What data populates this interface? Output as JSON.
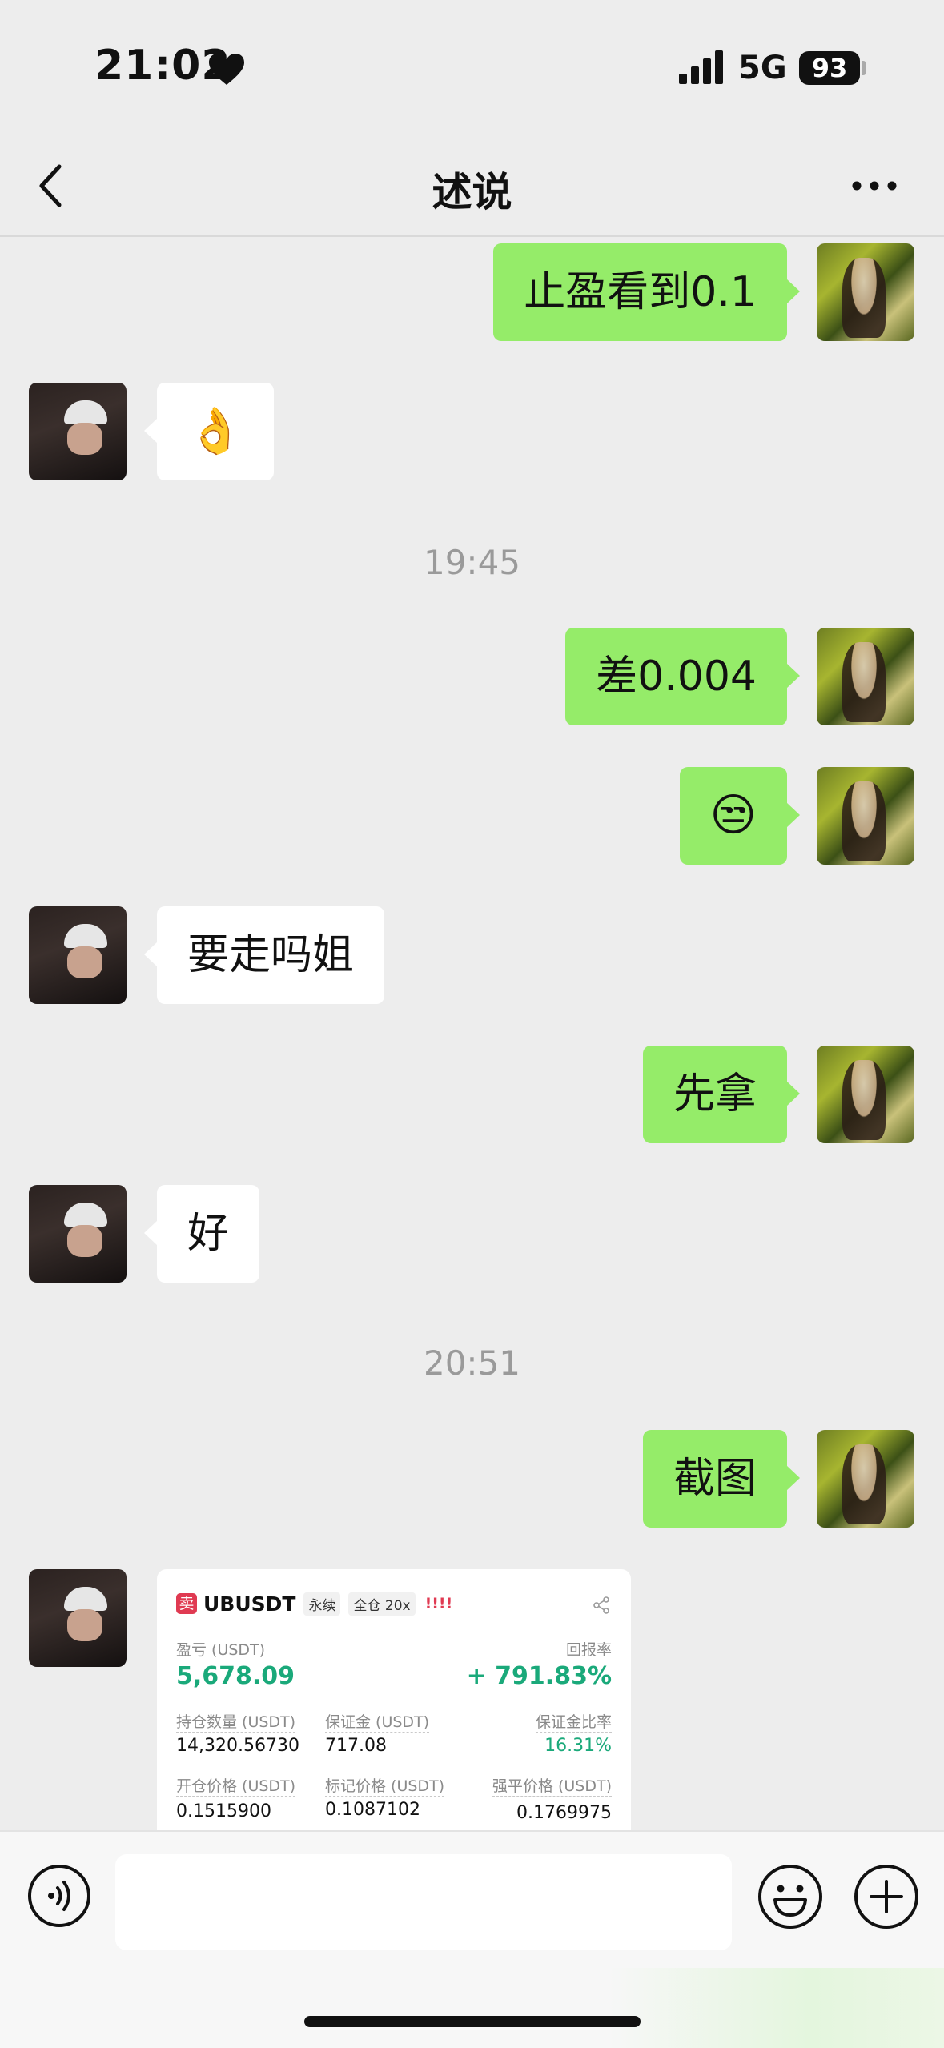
{
  "status_bar": {
    "time": "21:02",
    "network": "5G",
    "battery": "93"
  },
  "nav": {
    "title": "述说"
  },
  "messages": [
    {
      "side": "mine",
      "text": "止盈看到0.1"
    },
    {
      "side": "theirs",
      "text": "👌"
    },
    {
      "timestamp": "19:45"
    },
    {
      "side": "mine",
      "text": "差0.004"
    },
    {
      "side": "mine",
      "text": "😒"
    },
    {
      "side": "theirs",
      "text": "要走吗姐"
    },
    {
      "side": "mine",
      "text": "先拿"
    },
    {
      "side": "theirs",
      "text": "好"
    },
    {
      "timestamp": "20:51"
    },
    {
      "side": "mine",
      "text": "截图"
    }
  ],
  "trade_card": {
    "side_tag": "卖",
    "symbol": "UBUSDT",
    "contract_type": "永续",
    "margin_mode": "全仓 20x",
    "warning": "!!!!",
    "pnl_label": "盈亏 (USDT)",
    "pnl_value": "5,678.09",
    "roi_label": "回报率",
    "roi_value": "+ 791.83%",
    "size_label": "持仓数量 (USDT)",
    "size_value": "14,320.56730",
    "margin_label": "保证金 (USDT)",
    "margin_value": "717.08",
    "margin_ratio_label": "保证金比率",
    "margin_ratio_value": "16.31%",
    "entry_label": "开仓价格 (USDT)",
    "entry_value": "0.1515900",
    "mark_label": "标记价格 (USDT)",
    "mark_value": "0.1087102",
    "liq_label": "强平价格 (USDT)",
    "liq_value": "0.1769975"
  },
  "input_bar": {
    "placeholder": ""
  },
  "colors": {
    "my_bubble": "#95ec69",
    "their_bubble": "#ffffff",
    "profit_green": "#1aa97a",
    "sell_red": "#e03a52"
  },
  "icons": [
    "heart-icon",
    "signal-icon",
    "back-icon",
    "more-icon",
    "voice-icon",
    "emoji-icon",
    "plus-icon",
    "share-icon"
  ]
}
